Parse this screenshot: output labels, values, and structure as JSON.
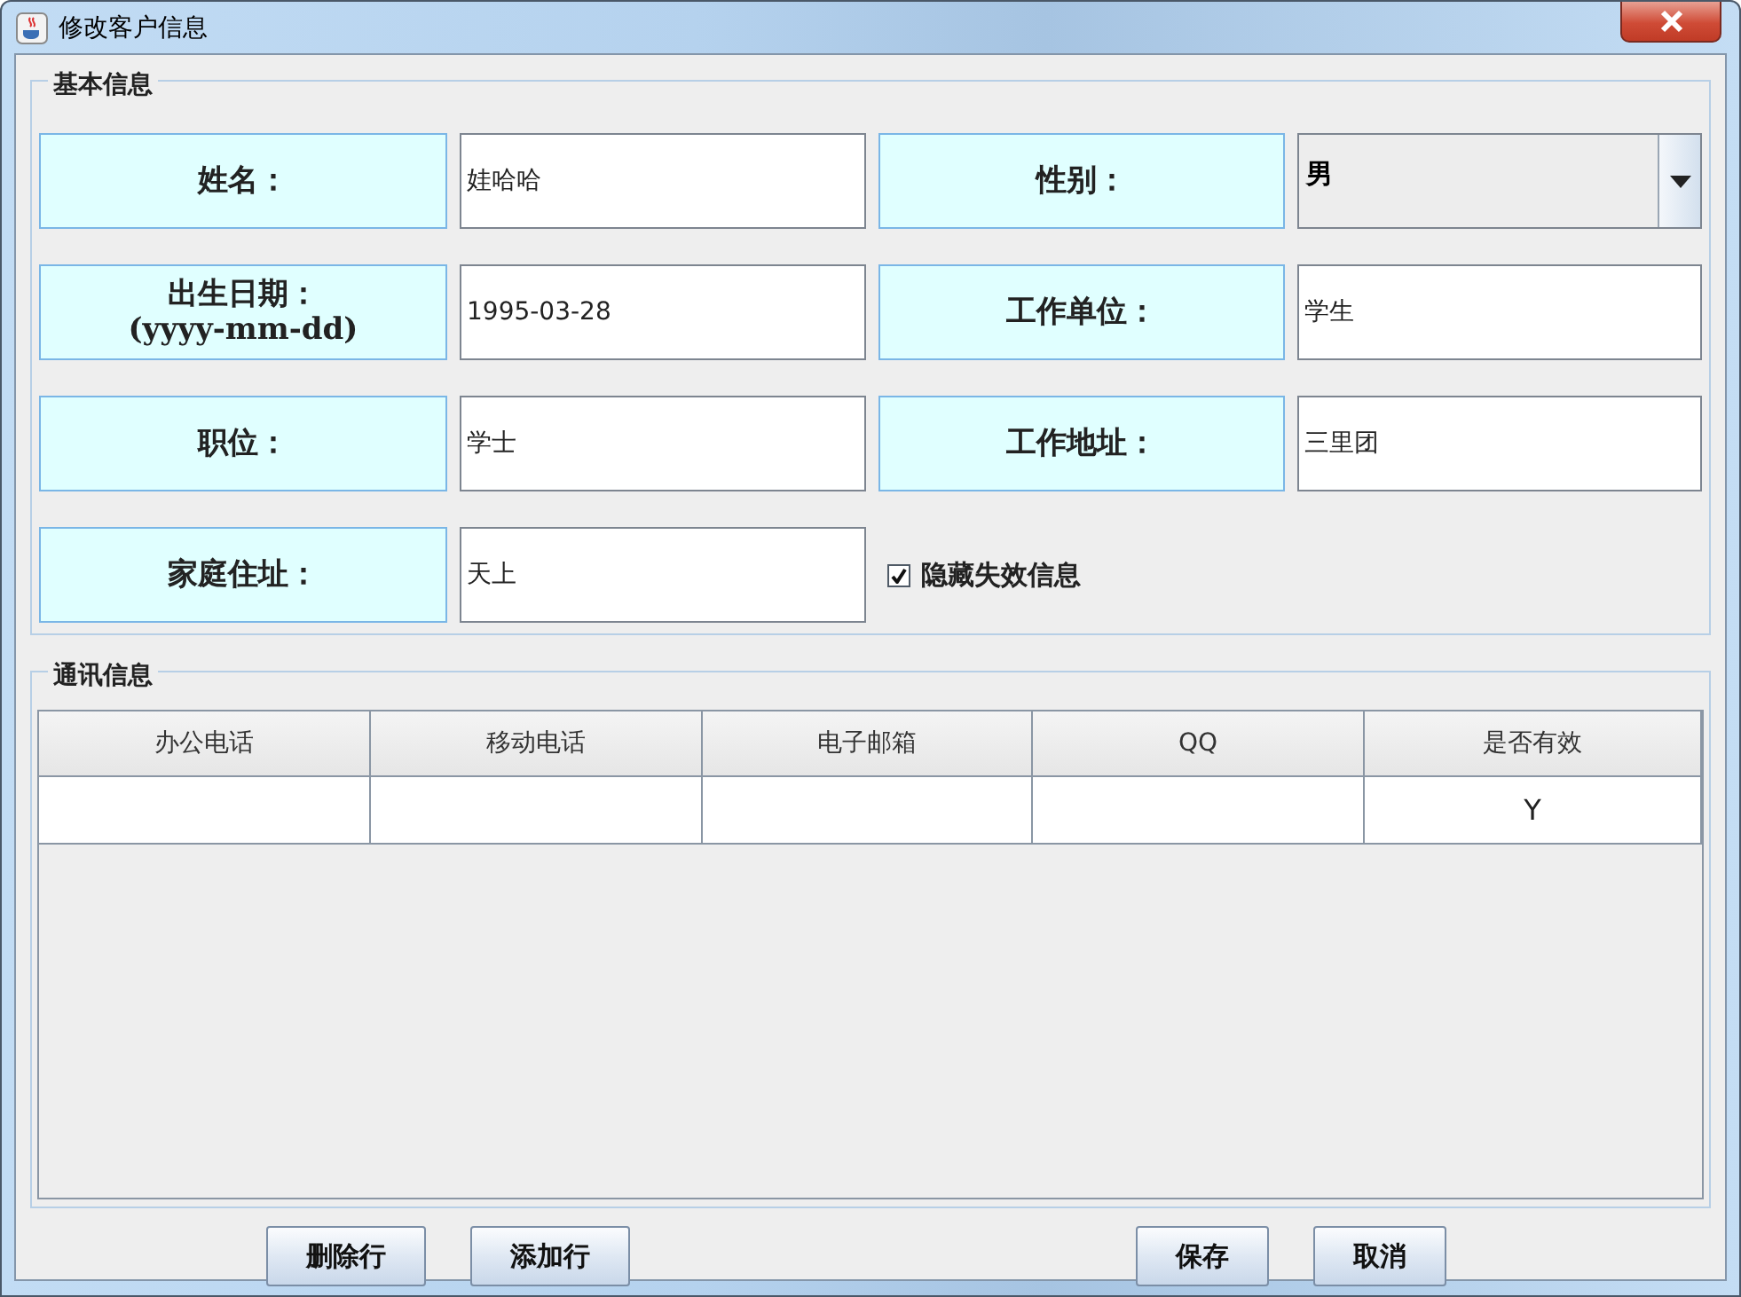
{
  "window": {
    "title": "修改客户信息"
  },
  "basic_info": {
    "title": "基本信息",
    "fields": [
      {
        "kind": "text",
        "label": "姓名：",
        "value": "娃哈哈"
      },
      {
        "kind": "select",
        "label": "性别：",
        "value": "男"
      },
      {
        "kind": "text",
        "label": "出生日期：",
        "hint": "(yyyy-mm-dd)",
        "value": "1995-03-28"
      },
      {
        "kind": "text",
        "label": "工作单位：",
        "value": "学生"
      },
      {
        "kind": "text",
        "label": "职位：",
        "value": "学士"
      },
      {
        "kind": "text",
        "label": "工作地址：",
        "value": "三里团"
      },
      {
        "kind": "text",
        "label": "家庭住址：",
        "value": "天上"
      },
      {
        "kind": "checkbox",
        "label": "隐藏失效信息",
        "checked": true
      }
    ]
  },
  "contact_info": {
    "title": "通讯信息",
    "table": {
      "columns": [
        "办公电话",
        "移动电话",
        "电子邮箱",
        "QQ",
        "是否有效"
      ],
      "rows": [
        [
          null,
          null,
          null,
          null,
          "Y"
        ]
      ]
    }
  },
  "left_buttons": [
    "删除行",
    "添加行"
  ],
  "right_buttons": [
    "保存",
    "取消"
  ]
}
